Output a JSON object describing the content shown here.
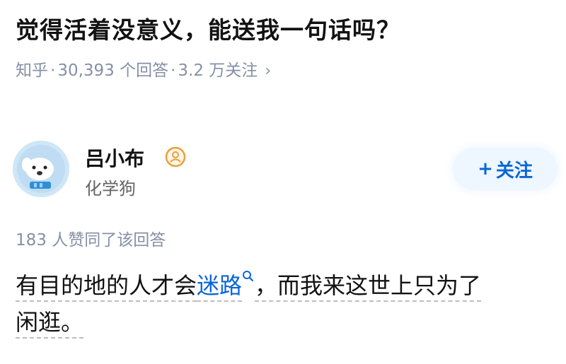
{
  "question": {
    "title": "觉得活着没意义，能送我一句话吗？",
    "source": "知乎",
    "answers": "30,393 个回答",
    "followers": "3.2 万关注",
    "chevron": "›"
  },
  "author": {
    "name": "吕小布",
    "headline": "化学狗",
    "avatar_icon": "dog-avatar-icon",
    "badge_icon": "verified-user-badge-icon",
    "follow_plus": "+",
    "follow_label": "关注"
  },
  "answer": {
    "vote_text": "183 人赞同了该回答",
    "segment_1": "有目的地的人才会",
    "link_text": "迷路",
    "segment_2": "，而我来这世上只为了",
    "segment_3": "闲逛。",
    "search_icon": "search-icon"
  },
  "colors": {
    "link": "#0a66d6",
    "meta": "#8590a6",
    "follow_bg": "#eef6ff"
  }
}
